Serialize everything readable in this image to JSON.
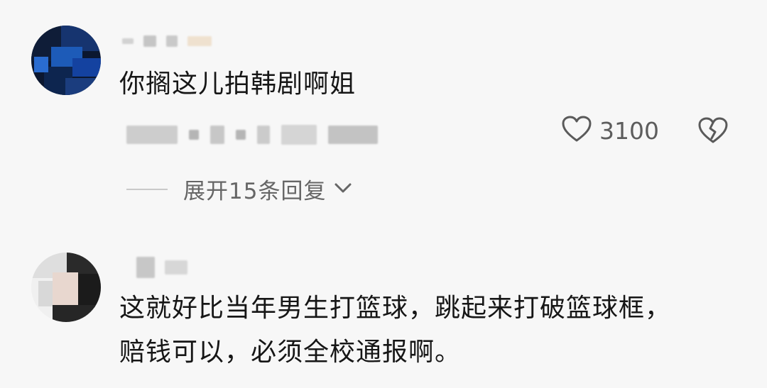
{
  "comments": [
    {
      "text_lines": [
        "你搁这儿拍韩剧啊姐"
      ],
      "like_count": "3100",
      "expand_replies_label": "展开15条回复"
    },
    {
      "text_lines": [
        "这就好比当年男生打篮球，跳起来打破篮球框，",
        "赔钱可以，必须全校通报啊。"
      ]
    }
  ],
  "icons": {
    "like": "heart-outline-icon",
    "dislike": "broken-heart-icon",
    "expand": "chevron-down-icon"
  },
  "colors": {
    "background": "#f7f7f7",
    "text": "#161616",
    "secondary_text": "#666666",
    "avatar_accent": "#1e4fa3"
  }
}
